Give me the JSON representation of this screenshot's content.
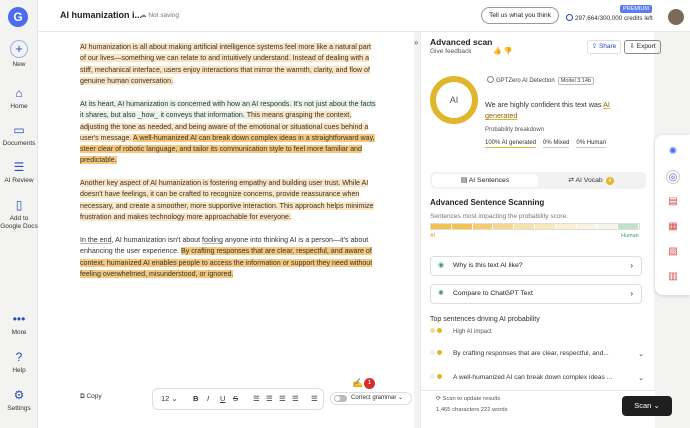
{
  "nav": {
    "logo": "G",
    "items": [
      {
        "label": "New",
        "icon": "plus-icon"
      },
      {
        "label": "Home",
        "icon": "home-icon"
      },
      {
        "label": "Documents",
        "icon": "folder-icon"
      },
      {
        "label": "AI Review",
        "icon": "checklist-icon"
      },
      {
        "label": "Add to Google Docs",
        "icon": "google-docs-icon"
      },
      {
        "label": "More",
        "icon": "more-icon"
      },
      {
        "label": "Help",
        "icon": "help-icon"
      },
      {
        "label": "Settings",
        "icon": "gear-icon"
      }
    ]
  },
  "header": {
    "title": "AI humanization i...",
    "saving": "Not saving",
    "feedback": "Tell us what you think",
    "plan": "PREMIUM",
    "credits": "297,664/300,000 credits left"
  },
  "editor": {
    "paragraphs": [
      [
        {
          "t": "AI humanization is all about making artificial intelligence systems feel more like a natural part of our lives—something we can relate to and intuitively understand. Instead of dealing with a stiff, mechanical interface, users enjoy interactions that mirror the warmth, clarity, and flow of genuine human conversation.",
          "h": "y"
        }
      ],
      [
        {
          "t": "At its heart, AI humanization is concerned with how an AI responds. It's not just about the facts it shares, but also ",
          "h": "g"
        },
        {
          "t": "_how_",
          "h": "g"
        },
        {
          "t": " it conveys that information. ",
          "h": "g"
        },
        {
          "t": "This means grasping the context, adjusting the tone as needed, and being aware of the emotional or situational cues behind a user's message. ",
          "h": "y"
        },
        {
          "t": "A well-humanized AI can break down complex ideas in a straightforward way, steer clear of robotic language, and tailor its communication style to feel more familiar and predictable.",
          "h": "o"
        }
      ],
      [
        {
          "t": "Another key aspect of AI humanization is fostering empathy and building user trust. While AI doesn't have feelings, it can be crafted to recognize concerns, provide reassurance when necessary, and create a smoother, more supportive interaction. This approach helps minimize frustration and makes technology more approachable for everyone.",
          "h": "y"
        }
      ],
      [
        {
          "t": "In the end",
          "h": "",
          "u": true
        },
        {
          "t": ", AI humanization isn't about ",
          "h": ""
        },
        {
          "t": "fooling",
          "h": "",
          "u": true
        },
        {
          "t": " anyone into thinking AI is a person—it's about enhancing the user experience. ",
          "h": ""
        },
        {
          "t": "By crafting responses that are clear, respectful, and aware of context, humanized AI enables people to access the information or support they need without feeling overwhelmed, misunderstood, or ignored.",
          "h": "o"
        }
      ]
    ],
    "toolbar": {
      "copy": "Copy",
      "font_size": "12",
      "bold": "B",
      "italic": "I",
      "underline": "U",
      "strike": "S",
      "grammar": "Correct grammar",
      "badge": "1"
    }
  },
  "panel": {
    "title": "Advanced scan",
    "give_feedback": "Give feedback",
    "share": "Share",
    "export": "Export",
    "gauge_label": "AI",
    "detector": "GPTZero AI Detection",
    "model": "Model 3.14b",
    "confidence_pre": "We are highly confident this text was ",
    "confidence_ai": "AI generated",
    "breakdown_label": "Probability breakdown",
    "breakdown": {
      "ai": "100% AI generated",
      "mixed": "0% Mixed",
      "human": "0% Human"
    },
    "tab_sentences": "AI Sentences",
    "tab_vocab": "AI Vocab",
    "vocab_count": "4",
    "adv_title": "Advanced Sentence Scanning",
    "adv_sub": "Sentences most impacting the probability score.",
    "axis_left": "AI",
    "axis_right": "Human",
    "bar_colors": [
      "#f2c14e",
      "#f2c14e",
      "#f4cc6c",
      "#f6d88d",
      "#f8e2a9",
      "#f8e7b8",
      "#faf0d3",
      "#f8f4e2",
      "#f4f6ee",
      "#bfe0cb"
    ],
    "q1": "Why is this text AI like?",
    "q2": "Compare to ChatGPT Text",
    "top_title": "Top sentences driving AI probability",
    "high_impact": "High AI impact",
    "sentences": [
      "By crafting responses that are clear, respectful, and...",
      "A well-humanized AI can break down complex ideas ..."
    ],
    "update": "Scan to update results",
    "chars": "1,465 characters 222 words",
    "scan": "Scan"
  }
}
